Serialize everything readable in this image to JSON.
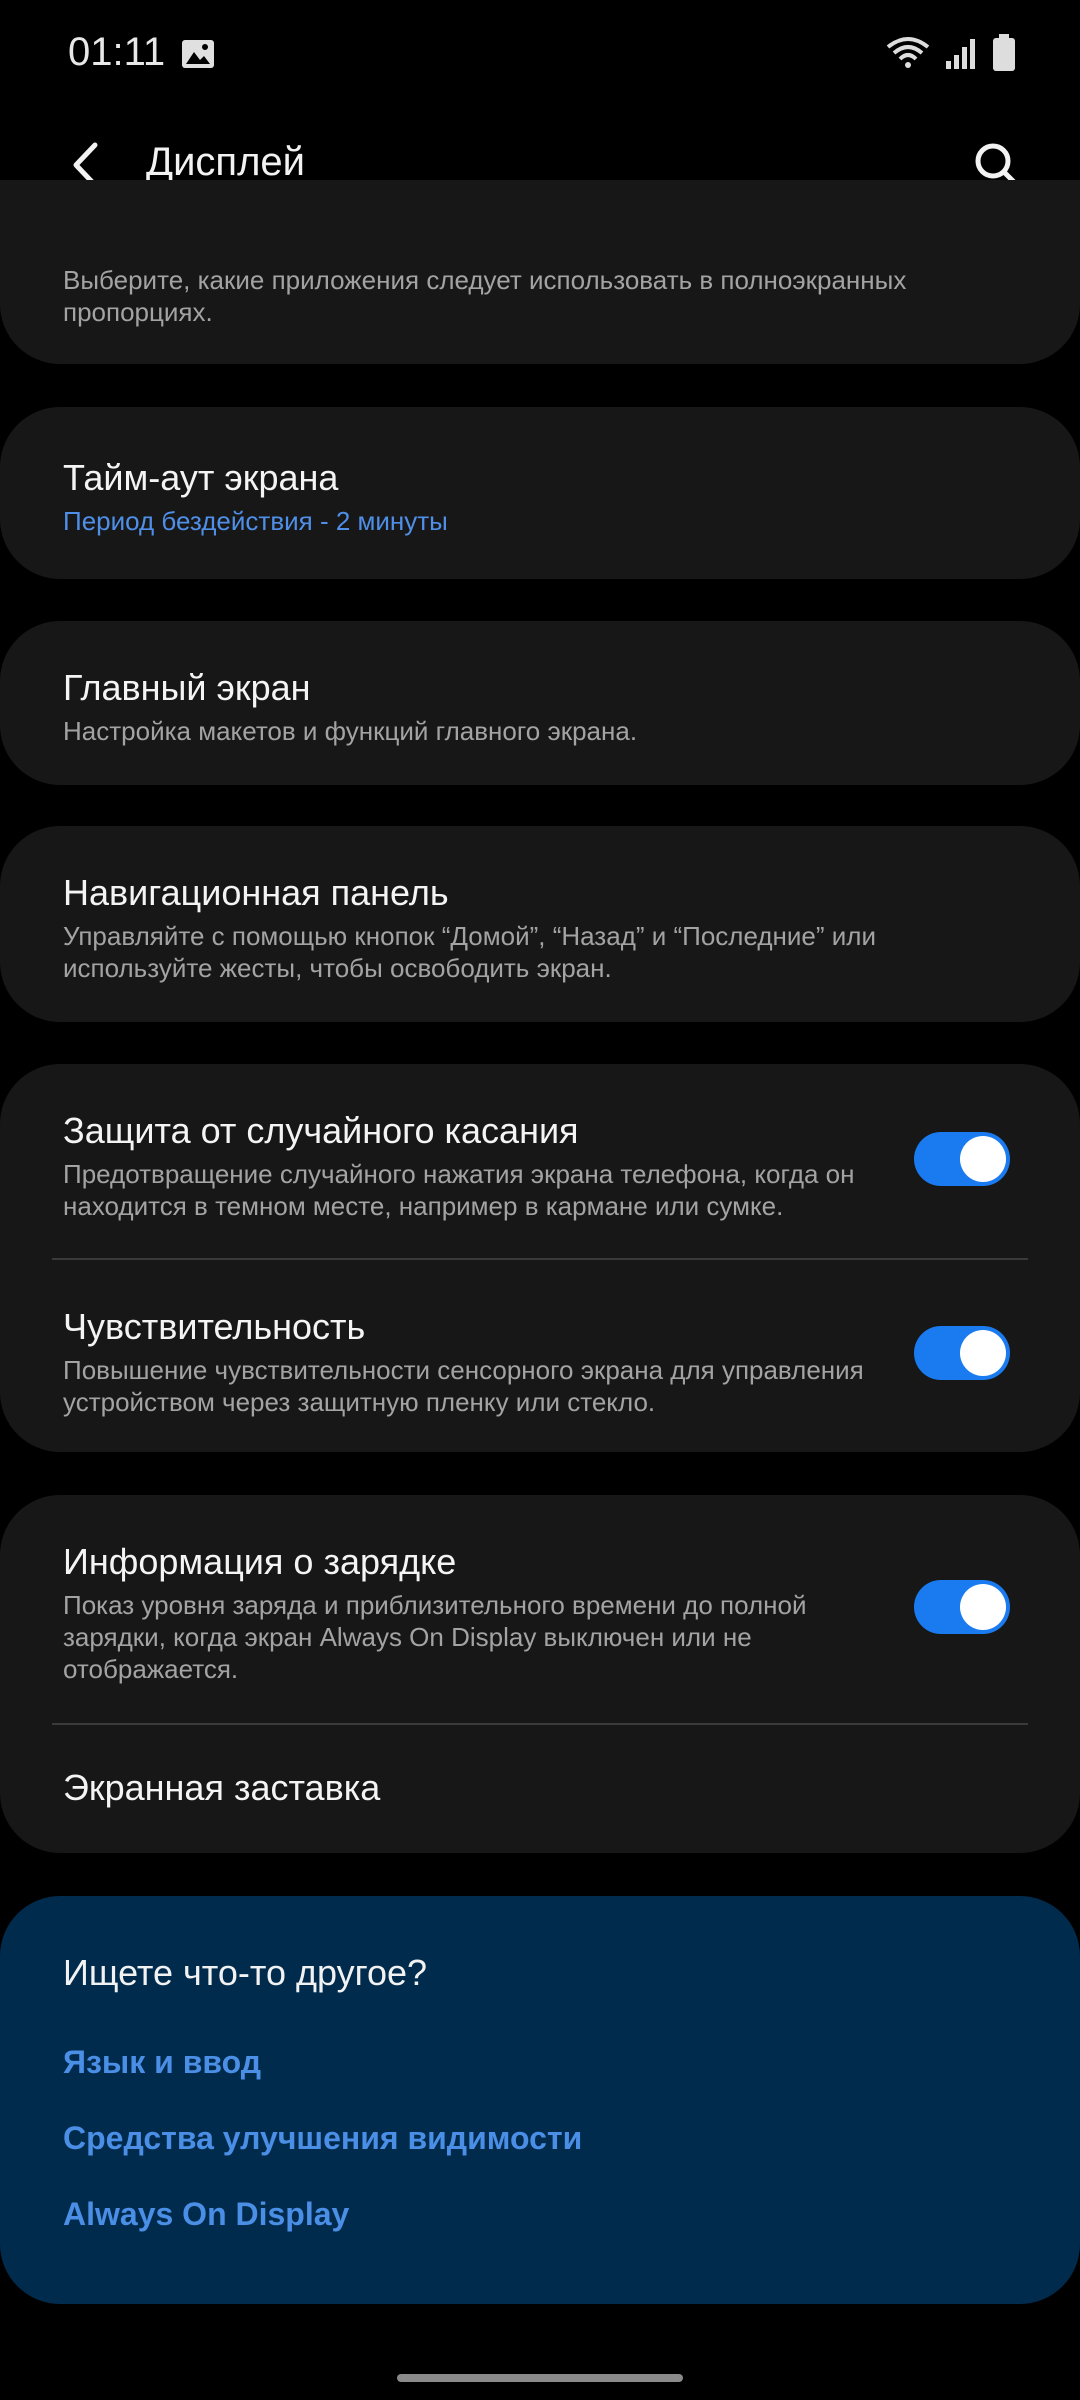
{
  "status": {
    "time": "01:11"
  },
  "header": {
    "title": "Дисплей"
  },
  "top_partial": {
    "subtitle": "Выберите, какие приложения следует использовать в полноэкранных пропорциях."
  },
  "settings": {
    "timeout": {
      "title": "Тайм-аут экрана",
      "subtitle": "Период бездействия - 2 минуты"
    },
    "home": {
      "title": "Главный экран",
      "subtitle": "Настройка макетов и функций главного экрана."
    },
    "navbar": {
      "title": "Навигационная панель",
      "subtitle": "Управляйте с помощью кнопок “Домой”, “Назад” и “Последние” или используйте жесты, чтобы освободить экран."
    },
    "accidental": {
      "title": "Защита от случайного касания",
      "subtitle": "Предотвращение случайного нажатия экрана телефона, когда он находится в темном месте, например в кармане или сумке.",
      "enabled": true
    },
    "sensitivity": {
      "title": "Чувствительность",
      "subtitle": "Повышение чувствительности сенсорного экрана для управления устройством через защитную пленку или стекло.",
      "enabled": true
    },
    "charging": {
      "title": "Информация о зарядке",
      "subtitle": "Показ уровня заряда и приблизительного времени до полной зарядки, когда экран Always On Display выключен или не отображается.",
      "enabled": true
    },
    "screensaver": {
      "title": "Экранная заставка"
    }
  },
  "looking_for_more": {
    "title": "Ищете что-то другое?",
    "links": [
      "Язык и ввод",
      "Средства улучшения видимости",
      "Always On Display"
    ]
  },
  "colors": {
    "accent": "#4f8fe8",
    "toggle_on": "#1a7bf0",
    "card": "#171717",
    "more_card": "#012b4d"
  }
}
